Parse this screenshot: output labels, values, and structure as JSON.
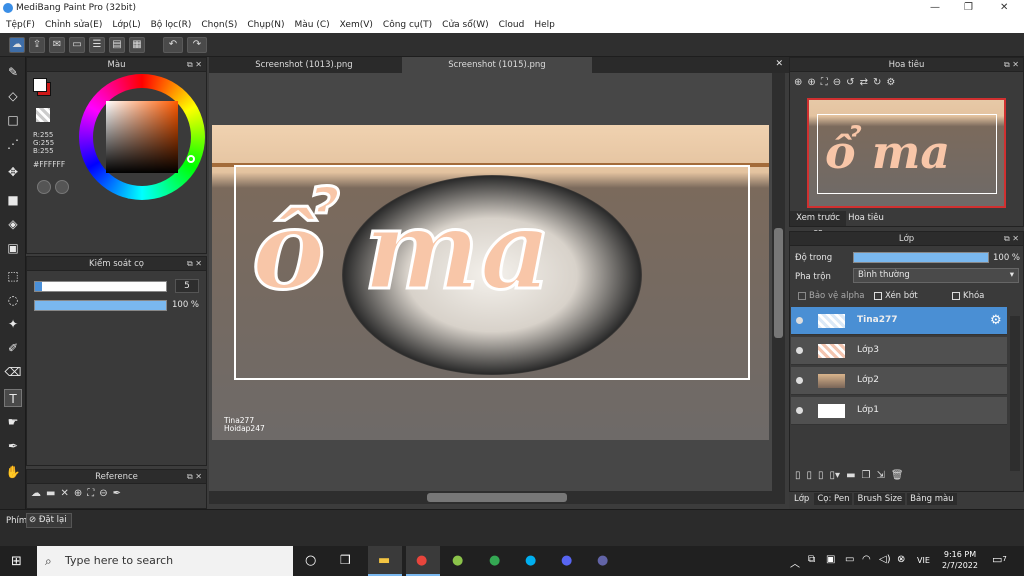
{
  "app": {
    "title": "MediBang Paint Pro (32bit)",
    "window_controls": [
      "—",
      "❐",
      "✕"
    ]
  },
  "menu": [
    "Tệp(F)",
    "Chỉnh sửa(E)",
    "Lớp(L)",
    "Bộ lọc(R)",
    "Chọn(S)",
    "Chụp(N)",
    "Màu (C)",
    "Xem(V)",
    "Công cụ(T)",
    "Cửa sổ(W)",
    "Cloud",
    "Help"
  ],
  "colors": {
    "accent": "#4a90d9",
    "primary_color": "#ffffff",
    "secondary_color": "#d01818",
    "selected_layer": "#4a8fd4"
  },
  "color_panel": {
    "title": "Màu",
    "r": "R:255",
    "g": "G:255",
    "b": "B:255",
    "hex": "#FFFFFF"
  },
  "brush_control": {
    "title": "Kiểm soát cọ",
    "size": "5",
    "opacity": "100 %",
    "size_fraction": 0.05,
    "opacity_fraction": 1.0
  },
  "reference": {
    "title": "Reference"
  },
  "tabs": [
    {
      "label": "Screenshot (1013).png",
      "active": false
    },
    {
      "label": "Screenshot (1015).png",
      "active": true
    }
  ],
  "canvas": {
    "title_text": "ổ ma",
    "watermark_line1": "Tina277",
    "watermark_line2": "Hoidap247"
  },
  "navigator": {
    "title": "Hoa tiêu",
    "tab_preview": "Xem trước cọ",
    "tab_navigator": "Hoa tiêu"
  },
  "layers_panel": {
    "title": "Lớp",
    "opacity_label": "Độ trong",
    "opacity_value": "100 %",
    "opacity_fraction": 1.0,
    "blend_label": "Pha trộn",
    "blend_value": "Bình thường",
    "protect_alpha": "Bảo vệ alpha",
    "clipping": "Xén bớt",
    "lock": "Khóa",
    "layers": [
      {
        "name": "Tina277",
        "selected": true
      },
      {
        "name": "Lớp3",
        "selected": false
      },
      {
        "name": "Lớp2",
        "selected": false
      },
      {
        "name": "Lớp1",
        "selected": false
      }
    ]
  },
  "bottom_tabs": [
    "Lớp",
    "Cọ: Pen",
    "Brush Size",
    "Bảng màu"
  ],
  "status": {
    "shortcut_label": "Phím",
    "reset_label": "Đặt lại"
  },
  "taskbar": {
    "search_placeholder": "Type here to search",
    "language": "VIE",
    "time": "9:16 PM",
    "date": "2/7/2022",
    "notifications": "7"
  }
}
